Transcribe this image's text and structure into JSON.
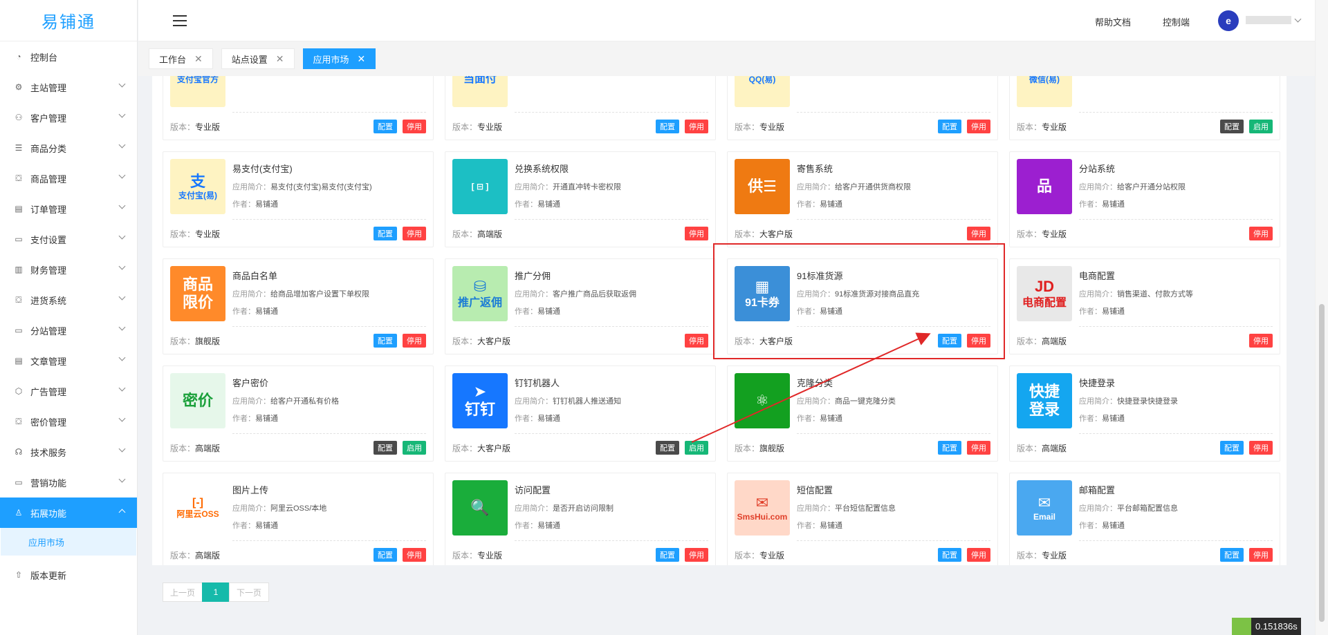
{
  "app": {
    "logo": "易铺通"
  },
  "sidebar": {
    "items": [
      {
        "label": "控制台",
        "icon": "dashboard-icon",
        "glyph": "◔"
      },
      {
        "label": "主站管理",
        "icon": "gear-icon",
        "glyph": "⚙"
      },
      {
        "label": "客户管理",
        "icon": "user-icon",
        "glyph": "⚇"
      },
      {
        "label": "商品分类",
        "icon": "list-icon",
        "glyph": "☰"
      },
      {
        "label": "商品管理",
        "icon": "bag-icon",
        "glyph": "⛋"
      },
      {
        "label": "订单管理",
        "icon": "clipboard-icon",
        "glyph": "▤"
      },
      {
        "label": "支付设置",
        "icon": "wallet-icon",
        "glyph": "▭"
      },
      {
        "label": "财务管理",
        "icon": "bar-chart-icon",
        "glyph": "▥"
      },
      {
        "label": "进货系统",
        "icon": "box-icon",
        "glyph": "⛋"
      },
      {
        "label": "分站管理",
        "icon": "monitor-icon",
        "glyph": "▭"
      },
      {
        "label": "文章管理",
        "icon": "doc-icon",
        "glyph": "▤"
      },
      {
        "label": "广告管理",
        "icon": "cube-icon",
        "glyph": "⬡"
      },
      {
        "label": "密价管理",
        "icon": "lock-icon",
        "glyph": "⛋"
      },
      {
        "label": "技术服务",
        "icon": "headset-icon",
        "glyph": "☊"
      },
      {
        "label": "营销功能",
        "icon": "screen-icon",
        "glyph": "▭"
      },
      {
        "label": "拓展功能",
        "icon": "rocket-icon",
        "glyph": "♙"
      }
    ],
    "sub_item": "应用市场",
    "update": {
      "label": "版本更新",
      "icon": "cloud-upload-icon",
      "glyph": "⇧"
    }
  },
  "header": {
    "help": "帮助文档",
    "console": "控制端",
    "avatar_text": "e"
  },
  "tabs": [
    {
      "label": "工作台",
      "close": "✕"
    },
    {
      "label": "站点设置",
      "close": "✕"
    },
    {
      "label": "应用市场",
      "close": "✕"
    }
  ],
  "labels": {
    "intro": "应用简介：",
    "author": "作者：",
    "version": "版本："
  },
  "cards": [
    {
      "name": "",
      "intro": "",
      "author": "易铺通",
      "version": "专业版",
      "btns": [
        "配置",
        "停用"
      ],
      "thumb": "支付宝官方",
      "color": "#fef3c2",
      "fg": "#1677ff"
    },
    {
      "name": "",
      "intro": "",
      "author": "易铺通",
      "version": "专业版",
      "btns": [
        "配置",
        "停用"
      ],
      "thumb": "当面付",
      "color": "#fef3c2",
      "fg": "#1677ff"
    },
    {
      "name": "",
      "intro": "",
      "author": "易铺通",
      "version": "专业版",
      "btns": [
        "配置",
        "停用"
      ],
      "thumb": "QQ(易)",
      "color": "#fef3c2",
      "fg": "#1677ff"
    },
    {
      "name": "",
      "intro": "",
      "author": "易铺通",
      "version": "专业版",
      "btns": [
        "配置",
        "启用"
      ],
      "thumb": "微信(易)",
      "color": "#fef3c2",
      "fg": "#1677ff"
    },
    {
      "name": "易支付(支付宝)",
      "intro": "易支付(支付宝)易支付(支付宝)",
      "author": "易铺通",
      "version": "专业版",
      "btns": [
        "配置",
        "停用"
      ],
      "thumb": "支\n支付宝(易)",
      "color": "#fef3c2",
      "fg": "#1677ff"
    },
    {
      "name": "兑换系统权限",
      "intro": "开通直冲转卡密权限",
      "author": "易铺通",
      "version": "高端版",
      "btns": [
        "停用"
      ],
      "thumb": "[ ⊟ ]",
      "color": "#1cbfc4",
      "fg": "#fff"
    },
    {
      "name": "寄售系统",
      "intro": "给客户开通供货商权限",
      "author": "易铺通",
      "version": "大客户版",
      "btns": [
        "停用"
      ],
      "thumb": "供☰",
      "color": "#ef7a12",
      "fg": "#fff"
    },
    {
      "name": "分站系统",
      "intro": "给客户开通分站权限",
      "author": "易铺通",
      "version": "专业版",
      "btns": [
        "停用"
      ],
      "thumb": "品",
      "color": "#9c1fd0",
      "fg": "#fff"
    },
    {
      "name": "商品白名单",
      "intro": "给商品增加客户设置下单权限",
      "author": "易铺通",
      "version": "旗舰版",
      "btns": [
        "配置",
        "停用"
      ],
      "thumb": "商品\n限价",
      "color": "#ff8a2a",
      "fg": "#fff"
    },
    {
      "name": "推广分佣",
      "intro": "客户推广商品后获取返佣",
      "author": "易铺通",
      "version": "大客户版",
      "btns": [
        "停用"
      ],
      "thumb": "⛁\n推广返佣",
      "color": "#b8ecb0",
      "fg": "#1a7bd6"
    },
    {
      "name": "91标准货源",
      "intro": "91标准货源对接商品直充",
      "author": "易铺通",
      "version": "大客户版",
      "btns": [
        "配置",
        "停用"
      ],
      "thumb": "▦\n91卡券",
      "color": "#3b8fd8",
      "fg": "#fff"
    },
    {
      "name": "电商配置",
      "intro": "销售渠道、付款方式等",
      "author": "易铺通",
      "version": "高端版",
      "btns": [
        "停用"
      ],
      "thumb": "JD\n电商配置",
      "color": "#e8e8e8",
      "fg": "#e02020"
    },
    {
      "name": "客户密价",
      "intro": "给客户开通私有价格",
      "author": "易铺通",
      "version": "高端版",
      "btns": [
        "配置",
        "启用"
      ],
      "thumb": "密价",
      "color": "#e6f7ea",
      "fg": "#1aa03a"
    },
    {
      "name": "钉钉机器人",
      "intro": "钉钉机器人推送通知",
      "author": "易铺通",
      "version": "大客户版",
      "btns": [
        "配置",
        "启用"
      ],
      "thumb": "➤\n钉钉",
      "color": "#1677ff",
      "fg": "#fff"
    },
    {
      "name": "克隆分类",
      "intro": "商品一键克隆分类",
      "author": "易铺通",
      "version": "旗舰版",
      "btns": [
        "配置",
        "停用"
      ],
      "thumb": "⚛",
      "color": "#13a020",
      "fg": "#fff"
    },
    {
      "name": "快捷登录",
      "intro": "快捷登录快捷登录",
      "author": "易铺通",
      "version": "高端版",
      "btns": [
        "配置",
        "停用"
      ],
      "thumb": "快捷\n登录",
      "color": "#14a6f0",
      "fg": "#fff"
    },
    {
      "name": "图片上传",
      "intro": "阿里云OSS/本地",
      "author": "易铺通",
      "version": "高端版",
      "btns": [
        "配置",
        "停用"
      ],
      "thumb": "[-]\n阿里云OSS",
      "color": "#fff",
      "fg": "#ff6a00"
    },
    {
      "name": "访问配置",
      "intro": "是否开启访问限制",
      "author": "易铺通",
      "version": "专业版",
      "btns": [
        "配置",
        "停用"
      ],
      "thumb": "🔍",
      "color": "#1aad3b",
      "fg": "#fff"
    },
    {
      "name": "短信配置",
      "intro": "平台短信配置信息",
      "author": "易铺通",
      "version": "专业版",
      "btns": [
        "配置",
        "停用"
      ],
      "thumb": "✉\nSmsHui.com",
      "color": "#ffd8c8",
      "fg": "#e0402a"
    },
    {
      "name": "邮箱配置",
      "intro": "平台邮箱配置信息",
      "author": "易铺通",
      "version": "专业版",
      "btns": [
        "配置",
        "停用"
      ],
      "thumb": "✉\nEmail",
      "color": "#4aa8f0",
      "fg": "#fff"
    }
  ],
  "pager": {
    "prev": "上一页",
    "current": "1",
    "next": "下一页"
  },
  "timer": "0.151836s",
  "colors": {
    "accent": "#1e9fff",
    "danger": "#ff4242",
    "success": "#16b777",
    "dark": "#4a4a4a",
    "pager": "#16baaa"
  }
}
